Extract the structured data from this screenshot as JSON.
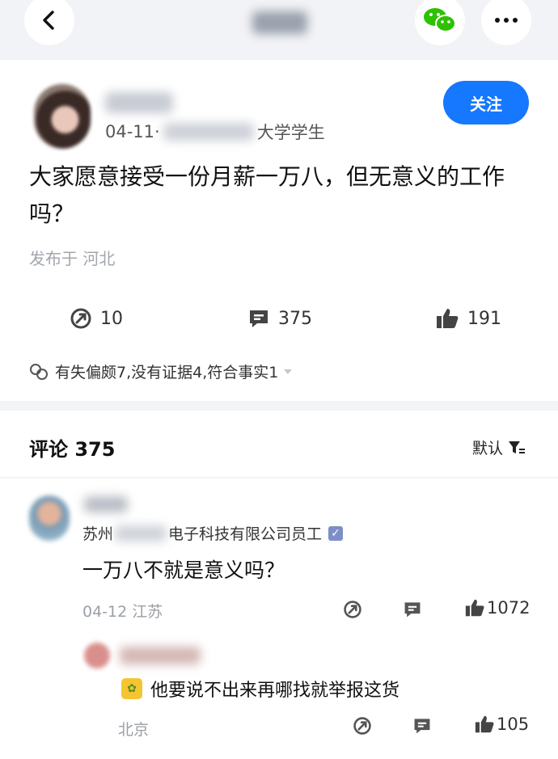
{
  "topbar": {
    "back_icon": "chevron-left-icon",
    "wechat_icon": "wechat-icon",
    "more_icon": "more-icon"
  },
  "post": {
    "date": "04-11·",
    "author_role": "大学学生",
    "follow_label": "关注",
    "question": "大家愿意接受一份月薪一万八，但无意义的工作吗？",
    "published_location": "发布于 河北",
    "stats": {
      "shares": "10",
      "comments": "375",
      "likes": "191"
    },
    "feedback": "有失偏颇7,没有证据4,符合事实1"
  },
  "comments": {
    "title": "评论 375",
    "sort_label": "默认",
    "items": [
      {
        "company_prefix": "苏州",
        "company_suffix": "电子科技有限公司员工",
        "text": "一万八不就是意义吗？",
        "date_location": "04-12 江苏",
        "likes": "1072",
        "reply": {
          "text": "他要说不出来再哪找就举报这货",
          "location": "北京",
          "likes": "105"
        }
      }
    ]
  },
  "colors": {
    "accent": "#1677ff",
    "wechat": "#2dc100"
  }
}
